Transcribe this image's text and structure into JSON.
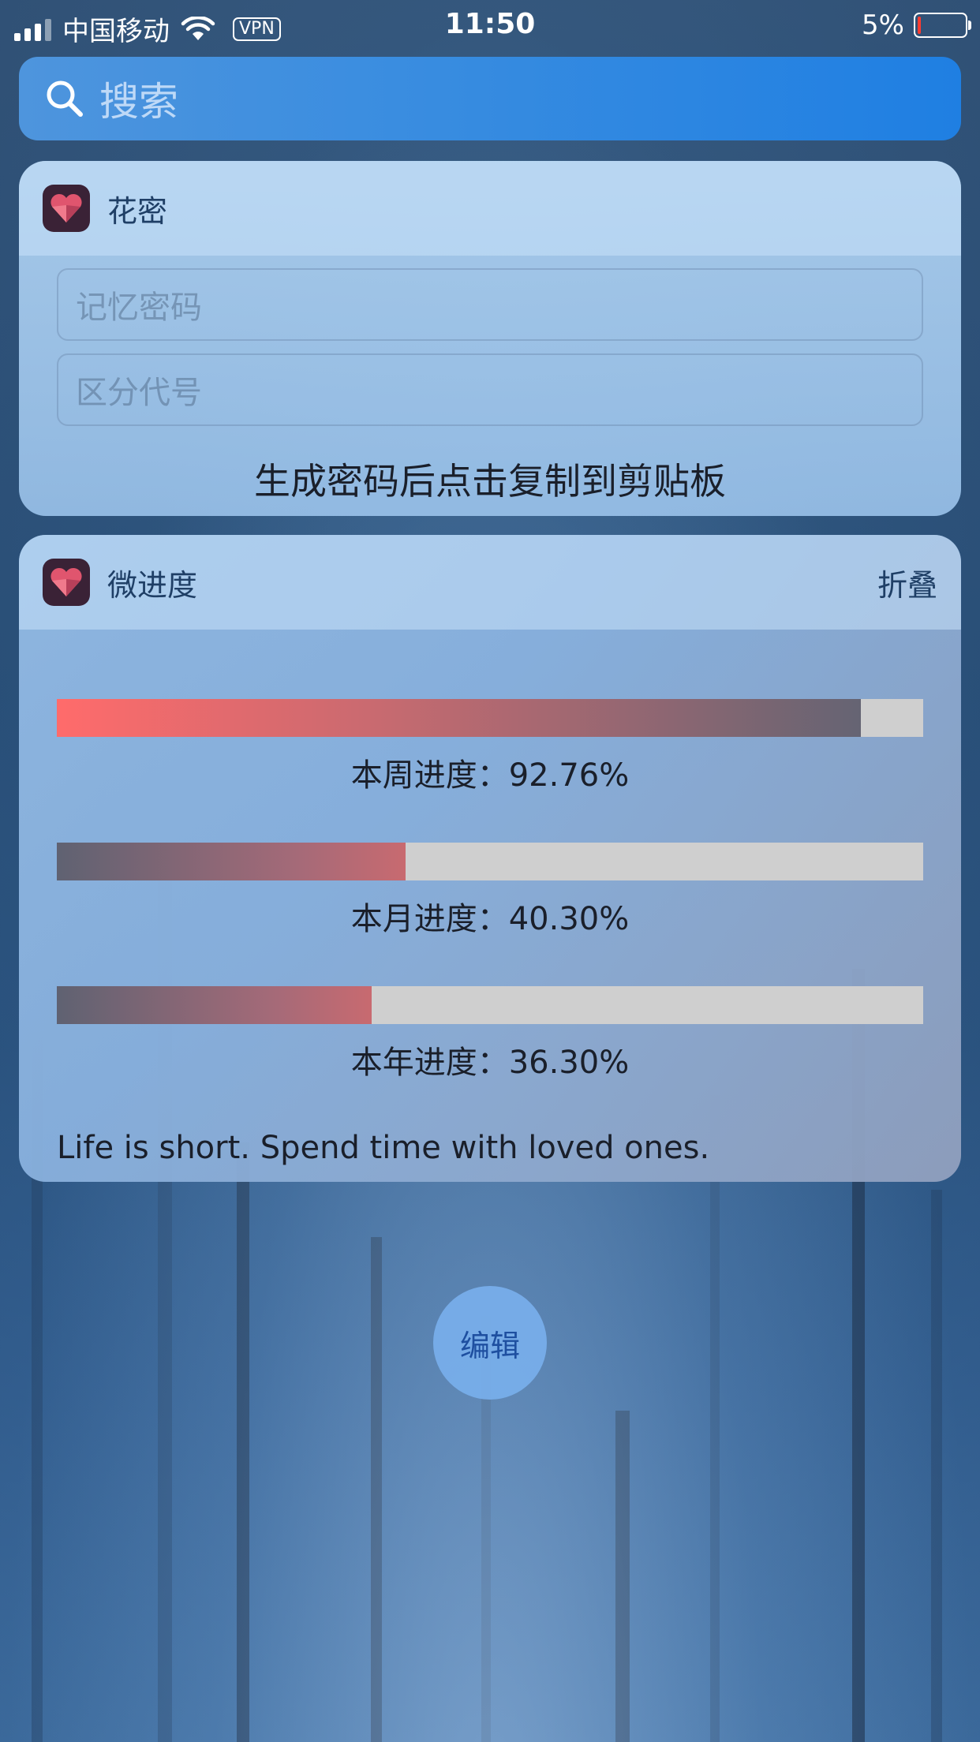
{
  "status_bar": {
    "carrier": "中国移动",
    "vpn": "VPN",
    "time": "11:50",
    "battery_percent": "5%",
    "battery_level": 0.05,
    "signal_icon": "signal-bars-icon",
    "wifi_icon": "wifi-icon"
  },
  "search": {
    "placeholder": "搜索",
    "icon": "search-icon"
  },
  "widget_huami": {
    "title": "花密",
    "icon": "heart-cube-app-icon",
    "memory_password_placeholder": "记忆密码",
    "distinguish_code_placeholder": "区分代号",
    "hint": "生成密码后点击复制到剪贴板"
  },
  "widget_progress": {
    "title": "微进度",
    "icon": "heart-cube-app-icon",
    "collapse_label": "折叠",
    "items": [
      {
        "label": "本周进度：92.76%",
        "value": 0.9276
      },
      {
        "label": "本月进度：40.30%",
        "value": 0.403
      },
      {
        "label": "本年进度：36.30%",
        "value": 0.363
      }
    ],
    "quote": "Life is short. Spend time with loved ones."
  },
  "edit_button": {
    "label": "编辑"
  },
  "colors": {
    "progress_start": "#ff6b6b",
    "progress_end": "#656473",
    "progress_track": "#cfcfcf",
    "search_bar": "#2f88e0"
  }
}
